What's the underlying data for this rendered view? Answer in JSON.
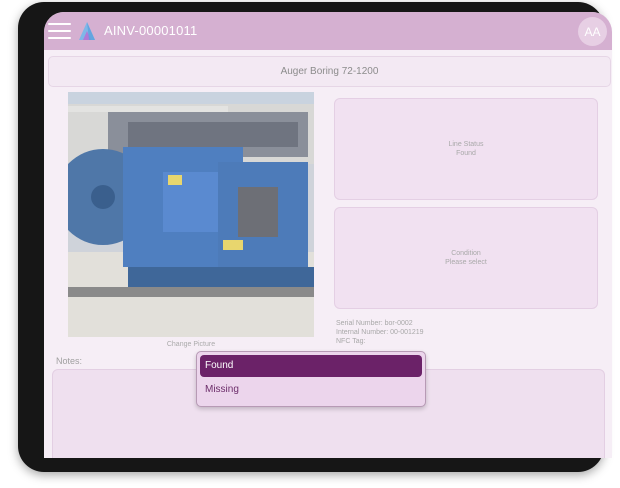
{
  "header": {
    "title": "AINV-00001011",
    "avatar_initials": "AA"
  },
  "asset": {
    "name": "Auger Boring 72-1200",
    "change_picture_label": "Change Picture"
  },
  "line_status": {
    "label": "Line Status",
    "value": "Found"
  },
  "condition": {
    "label": "Condition",
    "value": "Please select"
  },
  "details": {
    "serial_number": "Serial Number: bor-0002",
    "internal_number": "Internal Number: 00-001219",
    "nfc_tag": "NFC Tag:"
  },
  "notes": {
    "label": "Notes:"
  },
  "dropdown": {
    "options": [
      "Found",
      "Missing"
    ],
    "selected": "Found"
  },
  "colors": {
    "header_bar": "#d5b0d1",
    "selected_option": "#6b2268",
    "screen_background": "#f6eef6"
  },
  "icons": [
    "hamburger-menu-icon",
    "app-logo-icon"
  ]
}
